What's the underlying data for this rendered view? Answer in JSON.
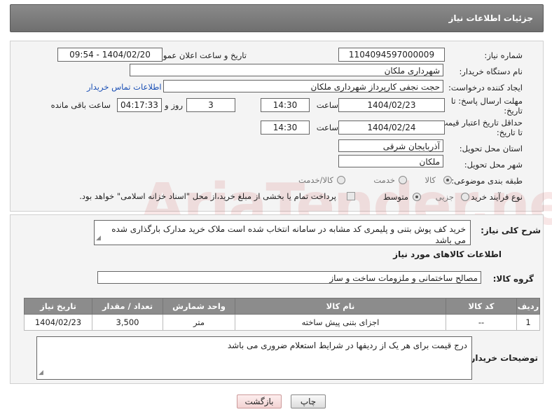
{
  "header": {
    "title": "جزئیات اطلاعات نیاز"
  },
  "form": {
    "need_number_label": "شماره نیاز:",
    "need_number": "1104094597000009",
    "announce_label": "تاریخ و ساعت اعلان عمومی:",
    "announce_value": "1404/02/20 - 09:54",
    "buyer_org_label": "نام دستگاه خریدار:",
    "buyer_org": "شهرداری ملکان",
    "requester_label": "ایجاد کننده درخواست:",
    "requester": "حجت نجفی کارپرداز شهرداری ملکان",
    "contact_link": "اطلاعات تماس خریدار",
    "deadline_label_1": "مهلت ارسال پاسخ: تا",
    "deadline_label_2": "تاریخ:",
    "deadline_date": "1404/02/23",
    "time_label": "ساعت",
    "deadline_time": "14:30",
    "days_value": "3",
    "days_label": "روز و",
    "remaining_time": "04:17:33",
    "remaining_label": "ساعت باقی مانده",
    "validity_label_1": "حداقل تاریخ اعتبار قیمت:",
    "validity_label_2": "تا تاریخ:",
    "validity_date": "1404/02/24",
    "validity_time": "14:30",
    "province_label": "استان محل تحویل:",
    "province": "آذربایجان شرقی",
    "city_label": "شهر محل تحویل:",
    "city": "ملکان",
    "category_label": "طبقه بندی موضوعی:",
    "category_options": [
      "کالا",
      "خدمت",
      "کالا/خدمت"
    ],
    "process_label": "نوع فرآیند خرید :",
    "process_options": [
      "جزیی",
      "متوسط"
    ],
    "payment_note": "پرداخت تمام یا بخشی از مبلغ خرید،از محل \"اسناد خزانه اسلامی\" خواهد بود."
  },
  "description": {
    "label": "شرح کلی نیاز:",
    "text": "خرید کف پوش بتنی و پلیمری کد مشابه در سامانه انتخاب شده است ملاک خرید مدارک بارگذاری شده می باشد"
  },
  "goods": {
    "section_title": "اطلاعات کالاهای مورد نیاز",
    "group_label": "گروه کالا:",
    "group_value": "مصالح ساختمانی و ملزومات ساخت و ساز",
    "columns": [
      "ردیف",
      "کد کالا",
      "نام کالا",
      "واحد شمارش",
      "تعداد / مقدار",
      "تاریخ نیاز"
    ],
    "rows": [
      {
        "row": "1",
        "code": "--",
        "name": "اجزای بتنی پیش ساخته",
        "unit": "متر",
        "qty": "3,500",
        "date": "1404/02/23"
      }
    ]
  },
  "buyer_notes": {
    "label": "توضیحات خریدار:",
    "text": "درج قیمت برای هر یک از ردیفها  در شرایط استعلام ضروری می باشد"
  },
  "buttons": {
    "print": "چاپ",
    "back": "بازگشت"
  },
  "watermark_text": "AriaTender.neT",
  "colors": {
    "header_bg": "#7d7d7d",
    "link": "#1a4fb5",
    "back_button_bg": "#f8dede"
  }
}
